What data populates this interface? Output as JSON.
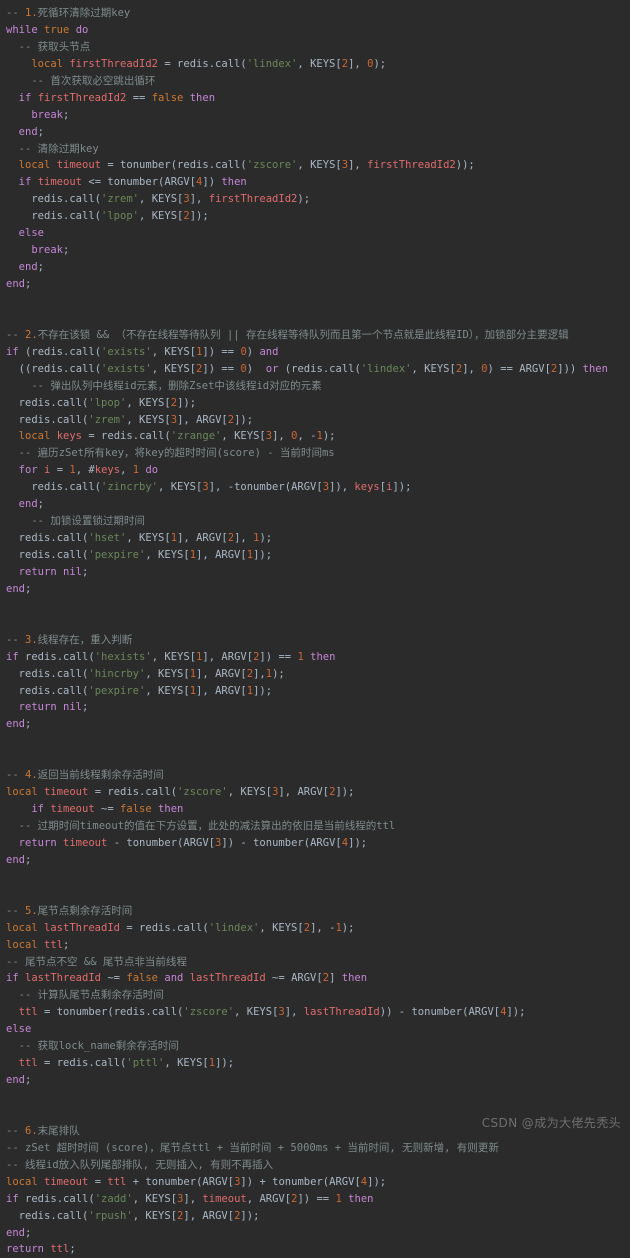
{
  "editor": {
    "language": "lua",
    "background_color": "#2b2b2b",
    "default_text_color": "#a9b7c6",
    "colors": {
      "comment": "#7f8c8d",
      "comment_number": "#cc7832",
      "keyword": "#c586d6",
      "keyword_alt": "#cc7832",
      "string": "#6a8759",
      "number": "#cc6633",
      "variable": "#e06c6c",
      "plain": "#a9b7c6"
    }
  },
  "watermark": {
    "text": "CSDN @成为大佬先秃头"
  },
  "code": {
    "lines": [
      "-- 1.死循环清除过期key",
      "while true do",
      "  -- 获取头节点",
      "    local firstThreadId2 = redis.call('lindex', KEYS[2], 0);",
      "    -- 首次获取必空跳出循环",
      "  if firstThreadId2 == false then",
      "    break;",
      "  end;",
      "  -- 清除过期key",
      "  local timeout = tonumber(redis.call('zscore', KEYS[3], firstThreadId2));",
      "  if timeout <= tonumber(ARGV[4]) then",
      "    redis.call('zrem', KEYS[3], firstThreadId2);",
      "    redis.call('lpop', KEYS[2]);",
      "  else",
      "    break;",
      "  end;",
      "end;",
      "",
      "",
      "-- 2.不存在该锁 && （不存在线程等待队列 || 存在线程等待队列而且第一个节点就是此线程ID），加锁部分主要逻辑",
      "if (redis.call('exists', KEYS[1]) == 0) and",
      "  ((redis.call('exists', KEYS[2]) == 0)  or (redis.call('lindex', KEYS[2], 0) == ARGV[2])) then",
      "    -- 弹出队列中线程id元素，删除Zset中该线程id对应的元素",
      "  redis.call('lpop', KEYS[2]);",
      "  redis.call('zrem', KEYS[3], ARGV[2]);",
      "  local keys = redis.call('zrange', KEYS[3], 0, -1);",
      "  -- 遍历zSet所有key，将key的超时时间(score) - 当前时间ms",
      "  for i = 1, #keys, 1 do",
      "    redis.call('zincrby', KEYS[3], -tonumber(ARGV[3]), keys[i]);",
      "  end;",
      "    -- 加锁设置锁过期时间",
      "  redis.call('hset', KEYS[1], ARGV[2], 1);",
      "  redis.call('pexpire', KEYS[1], ARGV[1]);",
      "  return nil;",
      "end;",
      "",
      "",
      "-- 3.线程存在，重入判断",
      "if redis.call('hexists', KEYS[1], ARGV[2]) == 1 then",
      "  redis.call('hincrby', KEYS[1], ARGV[2],1);",
      "  redis.call('pexpire', KEYS[1], ARGV[1]);",
      "  return nil;",
      "end;",
      "",
      "",
      "-- 4.返回当前线程剩余存活时间",
      "local timeout = redis.call('zscore', KEYS[3], ARGV[2]);",
      "    if timeout ~= false then",
      "  -- 过期时间timeout的值在下方设置，此处的减法算出的依旧是当前线程的ttl",
      "  return timeout - tonumber(ARGV[3]) - tonumber(ARGV[4]);",
      "end;",
      "",
      "",
      "-- 5.尾节点剩余存活时间",
      "local lastThreadId = redis.call('lindex', KEYS[2], -1);",
      "local ttl;",
      "-- 尾节点不空 && 尾节点非当前线程",
      "if lastThreadId ~= false and lastThreadId ~= ARGV[2] then",
      "  -- 计算队尾节点剩余存活时间",
      "  ttl = tonumber(redis.call('zscore', KEYS[3], lastThreadId)) - tonumber(ARGV[4]);",
      "else",
      "  -- 获取lock_name剩余存活时间",
      "  ttl = redis.call('pttl', KEYS[1]);",
      "end;",
      "",
      "",
      "-- 6.末尾排队",
      "-- zSet 超时时间 (score)，尾节点ttl + 当前时间 + 5000ms + 当前时间, 无则新增, 有则更新",
      "-- 线程id放入队列尾部排队, 无则插入, 有则不再插入",
      "local timeout = ttl + tonumber(ARGV[3]) + tonumber(ARGV[4]);",
      "if redis.call('zadd', KEYS[3], timeout, ARGV[2]) == 1 then",
      "  redis.call('rpush', KEYS[2], ARGV[2]);",
      "end;",
      "return ttl;"
    ]
  }
}
